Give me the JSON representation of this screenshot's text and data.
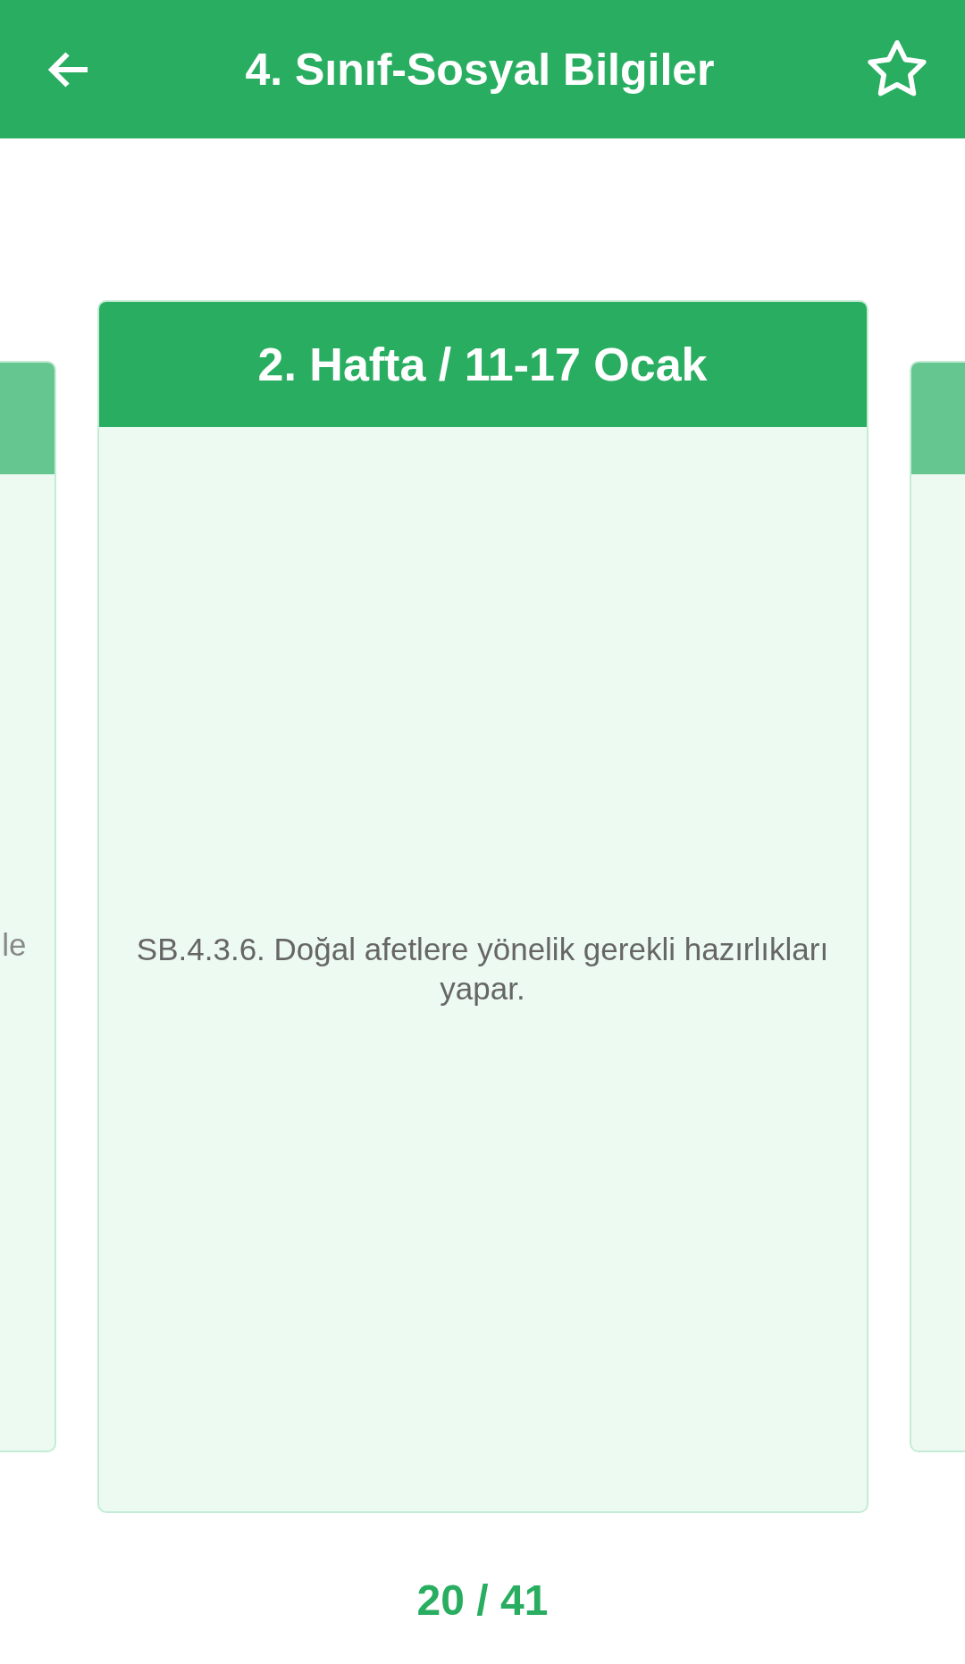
{
  "app_bar": {
    "title": "4. Sınıf-Sosyal Bilgiler",
    "favorite": false
  },
  "cards": [
    {
      "selected": false,
      "text": "le"
    },
    {
      "selected": true,
      "title": "2. Hafta / 11-17 Ocak",
      "text": "SB.4.3.6. Doğal afetlere yönelik gerekli hazırlıkları yapar."
    },
    {
      "selected": false
    }
  ],
  "counter": "20 / 41"
}
